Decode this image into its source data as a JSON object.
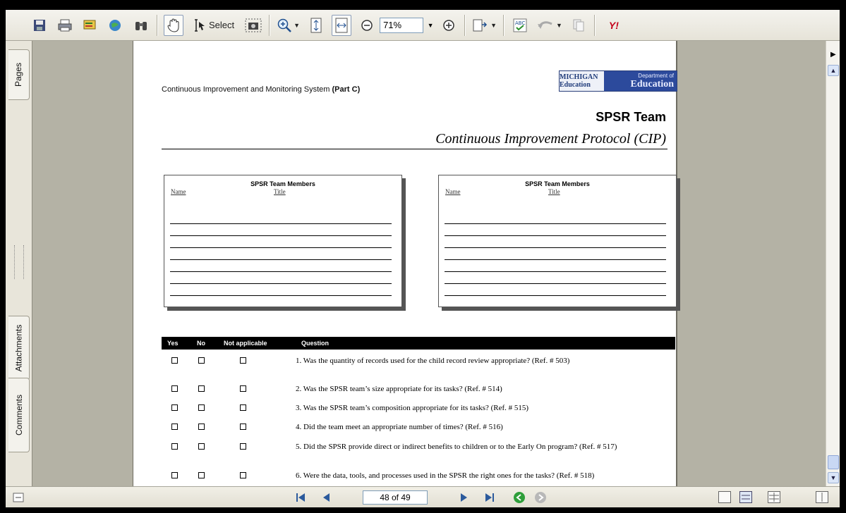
{
  "toolbar": {
    "select_label": "Select",
    "zoom_value": "71%"
  },
  "icons": [
    "save-icon",
    "print-icon",
    "email-icon",
    "search-icon",
    "binoculars-icon",
    "hand-tool-icon",
    "select-cursor-icon",
    "snapshot-icon",
    "zoom-in-icon",
    "fit-page-icon",
    "fit-width-icon",
    "zoom-out-minus-icon",
    "zoom-plus-icon",
    "page-tools-icon",
    "spellcheck-icon",
    "undo-icon",
    "copy-icon",
    "yahoo-icon"
  ],
  "yahoo_label": "Y!",
  "nav_tabs": {
    "pages": "Pages",
    "attachments": "Attachments",
    "comments": "Comments"
  },
  "document": {
    "header_prefix": "Continuous Improvement and Monitoring System",
    "header_part": "(Part C)",
    "logo_michigan": "MICHIGAN Education",
    "logo_dept_line1": "Department of",
    "logo_dept_line2": "Education",
    "title": "SPSR Team",
    "subtitle": "Continuous Improvement Protocol (CIP)",
    "members_box": {
      "heading": "SPSR Team Members",
      "col_name": "Name",
      "col_title": "Title"
    },
    "question_table": {
      "headers": {
        "yes": "Yes",
        "no": "No",
        "na": "Not applicable",
        "question": "Question"
      },
      "rows": [
        {
          "text": "1. Was the quantity of records used for the child record review appropriate? (Ref. # 503)"
        },
        {
          "text": "2. Was the SPSR team’s size appropriate for its tasks? (Ref. # 514)"
        },
        {
          "text": "3. Was the SPSR team’s composition appropriate for its tasks? (Ref. # 515)"
        },
        {
          "text": "4. Did the team meet an appropriate number of times? (Ref. # 516)"
        },
        {
          "text": "5. Did the SPSR provide direct or indirect benefits to children or to the Early On program? (Ref. # 517)"
        },
        {
          "text": "6. Were the data, tools, and processes used in the SPSR the right ones for the tasks? (Ref. # 518)"
        }
      ]
    }
  },
  "status": {
    "page_indicator": "48 of 49"
  },
  "colors": {
    "toolbar_bg": "#ece9dc",
    "doc_bg": "#b4b2a5",
    "accent": "#2b5a9c",
    "logo_blue": "#2c4a9c"
  }
}
